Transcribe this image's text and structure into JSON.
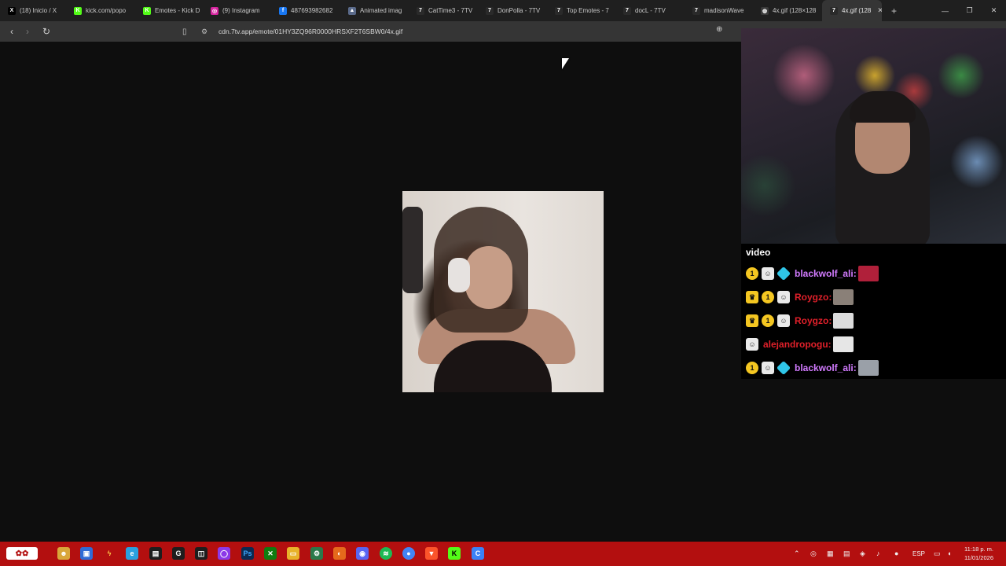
{
  "browser": {
    "tabs": [
      {
        "label": "(18) Inicio / X",
        "icon": "x-icon",
        "color": "#000000",
        "glyph": "X"
      },
      {
        "label": "kick.com/popo",
        "icon": "kick-icon",
        "color": "#53fc18",
        "glyph": "K"
      },
      {
        "label": "Emotes - Kick D",
        "icon": "kick-icon",
        "color": "#53fc18",
        "glyph": "K"
      },
      {
        "label": "(9) Instagram",
        "icon": "instagram-icon",
        "color": "#d6249f",
        "glyph": "◎"
      },
      {
        "label": "487693982682",
        "icon": "facebook-icon",
        "color": "#1877f2",
        "glyph": "f"
      },
      {
        "label": "Animated imag",
        "icon": "app-icon",
        "color": "#5a6a8a",
        "glyph": "▲"
      },
      {
        "label": "CatTime3 - 7TV",
        "icon": "7tv-icon",
        "color": "#2a2a2a",
        "glyph": "7"
      },
      {
        "label": "DonPolla - 7TV",
        "icon": "7tv-icon",
        "color": "#2a2a2a",
        "glyph": "7"
      },
      {
        "label": "Top Emotes - 7",
        "icon": "7tv-icon",
        "color": "#2a2a2a",
        "glyph": "7"
      },
      {
        "label": "docL - 7TV",
        "icon": "7tv-icon",
        "color": "#2a2a2a",
        "glyph": "7"
      },
      {
        "label": "madisonWave",
        "icon": "7tv-icon",
        "color": "#2a2a2a",
        "glyph": "7"
      },
      {
        "label": "4x.gif (128×128",
        "icon": "globe-icon",
        "color": "#3a3a3a",
        "glyph": "◍"
      },
      {
        "label": "4x.gif (128",
        "icon": "7tv-icon",
        "color": "#2a2a2a",
        "glyph": "7",
        "active": true
      }
    ],
    "new_tab": "+",
    "url": "cdn.7tv.app/emote/01HY3ZQ96R0000HRSXF2T6SBW0/4x.gif"
  },
  "stream": {
    "chat_title": "video",
    "messages": [
      {
        "badges": [
          "one",
          "cat",
          "gem"
        ],
        "user": "blackwolf_ali:",
        "color": "#d27bff",
        "emote_color": "#b0203a"
      },
      {
        "badges": [
          "crown",
          "one",
          "cat"
        ],
        "user": "Roygzo:",
        "color": "#e0202a",
        "emote_color": "#8a8078"
      },
      {
        "badges": [
          "crown",
          "one",
          "cat"
        ],
        "user": "Roygzo:",
        "color": "#e0202a",
        "emote_color": "#dcdcdc"
      },
      {
        "badges": [
          "cat"
        ],
        "user": "alejandropogu:",
        "color": "#e0202a",
        "emote_color": "#e6e6e6"
      },
      {
        "badges": [
          "one",
          "cat",
          "gem"
        ],
        "user": "blackwolf_ali:",
        "color": "#d27bff",
        "emote_color": "#9aa0a8"
      }
    ]
  },
  "taskbar": {
    "language": "ESP",
    "time": "11:18 p. m.",
    "date": "11/01/2026"
  }
}
